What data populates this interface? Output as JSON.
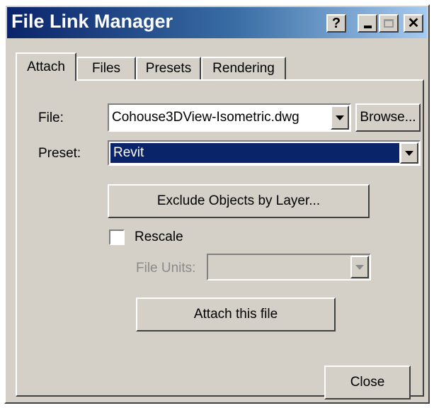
{
  "window": {
    "title": "File Link Manager",
    "buttons": {
      "help": "?",
      "close": "✕"
    }
  },
  "tabs": [
    "Attach",
    "Files",
    "Presets",
    "Rendering"
  ],
  "attach": {
    "file_label": "File:",
    "file_value": "Cohouse3DView-Isometric.dwg",
    "browse_label": "Browse...",
    "preset_label": "Preset:",
    "preset_value": "Revit",
    "exclude_label": "Exclude Objects by Layer...",
    "rescale_label": "Rescale",
    "rescale_checked": false,
    "file_units_label": "File Units:",
    "file_units_value": "",
    "attach_label": "Attach this file"
  },
  "footer": {
    "close_label": "Close"
  },
  "colors": {
    "titlebar_start": "#0a246a",
    "titlebar_end": "#a6caf0",
    "face": "#d4d0c8",
    "selection": "#0a246a"
  }
}
